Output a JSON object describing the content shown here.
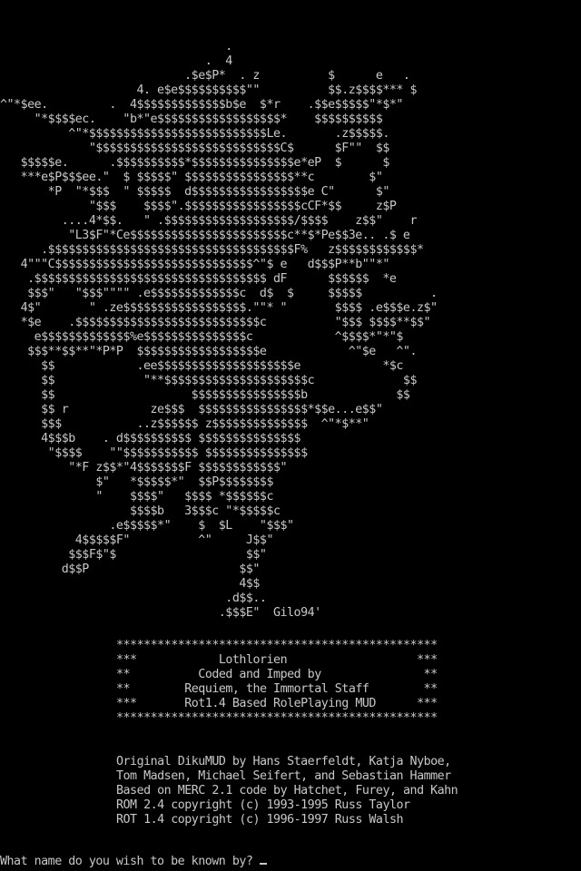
{
  "ascii_art": {
    "lines": [
      "                                 .",
      "                              .  4",
      "                           .$e$P*  . z          $      e   .",
      "                    4. e$e$$$$$$$$$$\"\"          $$.z$$$$*** $",
      "^\"*$ee.         .  4$$$$$$$$$$$$$b$e  $*r    .$$e$$$$$\"*$*\"",
      "     \"*$$$$ec.    \"b*\"e$$$$$$$$$$$$$$$$$$*    $$$$$$$$$$",
      "          ^\"*$$$$$$$$$$$$$$$$$$$$$$$$$$Le.       .z$$$$$.",
      "             \"$$$$$$$$$$$$$$$$$$$$$$$$$$$C$      $F\"\"  $$",
      "   $$$$$e.      .$$$$$$$$$$*$$$$$$$$$$$$$$$e*eP  $      $",
      "   ***e$P$$$ee.\"  $ $$$$$\" $$$$$$$$$$$$$$$$**c        $\"",
      "       *P  \"*$$$  \" $$$$$  d$$$$$$$$$$$$$$$$$e C\"      $\"",
      "             \"$$$    $$$$\".$$$$$$$$$$$$$$$$$cCF*$$     z$P",
      "         ....4*$$.   \" .$$$$$$$$$$$$$$$$$$$/$$$$    z$$\"    r",
      "          \"L3$F\"*Ce$$$$$$$$$$$$$$$$$$$$$$$c**$*Pe$$3e.. .$ e",
      "      .$$$$$$$$$$$$$$$$$$$$$$$$$$$$$$$$$$$$F%   z$$$$$$$$$$$$*",
      "   4\"\"\"C$$$$$$$$$$$$$$$$$$$$$$$$$$$$$^\"$ e   d$$$P**b\"\"*\"",
      "    .$$$$$$$$$$$$$$$$$$$$$$$$$$$$$$$$$$ dF      $$$$$$  *e",
      "    $$$\"   \"$$$\"\"\"\" .e$$$$$$$$$$$$$c  d$  $     $$$$$          .",
      "   4$\"       \" .ze$$$$$$$$$$$$$$$$$$.\"\"* \"       $$$$ .e$$$e.z$\"",
      "   *$e    .$$$$$$$$$$$$$$$$$$$$$$$$$$$c          \"$$$ $$$$**$$\"",
      "     e$$$$$$$$$$$$$%e$$$$$$$$$$$$$$$c            ^$$$$*\"*\"$",
      "    $$$**$$**\"*P*P  $$$$$$$$$$$$$$$$$$e            ^\"$e   ^\".",
      "      $$            .ee$$$$$$$$$$$$$$$$$$$$e            *$c",
      "      $$             \"**$$$$$$$$$$$$$$$$$$$$$c             $$",
      "      $$                    $$$$$$$$$$$$$$$$b             $$",
      "      $$ r            ze$$$  $$$$$$$$$$$$$$$$*$$e...e$$\"",
      "      $$$           ..z$$$$$$ z$$$$$$$$$$$$$$  ^\"*$**\"",
      "      4$$$b    . d$$$$$$$$$$ $$$$$$$$$$$$$$$",
      "       \"$$$$    \"\"$$$$$$$$$$$ $$$$$$$$$$$$$$$",
      "          \"*F z$$*\"4$$$$$$$F $$$$$$$$$$$$\"",
      "              $\"   *$$$$$*\"  $$P$$$$$$$$",
      "              \"    $$$$\"   $$$$ *$$$$$$c",
      "                   $$$$b   3$$$c \"*$$$$$c",
      "                .e$$$$$*\"    $  $L    \"$$$\"",
      "           4$$$$$F\"          ^\"     J$$\"",
      "          $$$F$\"$                   $$\"",
      "         d$$P                      $$\"",
      "                                   4$$",
      "                                 .d$$..",
      "                                .$$$E\"  Gilo94'"
    ]
  },
  "banner": {
    "lines": [
      "***********************************************",
      "***            Lothlorien                   ***",
      "**          Coded and Imped by               **",
      "**        Requiem, the Immortal Staff        **",
      "***       Rot1.4 Based RolePlaying MUD      ***",
      "***********************************************"
    ]
  },
  "credits": {
    "lines": [
      "Original DikuMUD by Hans Staerfeldt, Katja Nyboe,",
      "Tom Madsen, Michael Seifert, and Sebastian Hammer",
      "Based on MERC 2.1 code by Hatchet, Furey, and Kahn",
      "ROM 2.4 copyright (c) 1993-1995 Russ Taylor",
      "ROT 1.4 copyright (c) 1996-1997 Russ Walsh"
    ]
  },
  "prompt": {
    "text": "What name do you wish to be known by?",
    "input_value": ""
  },
  "colors": {
    "background": "#000000",
    "foreground": "#c8c8c8"
  }
}
